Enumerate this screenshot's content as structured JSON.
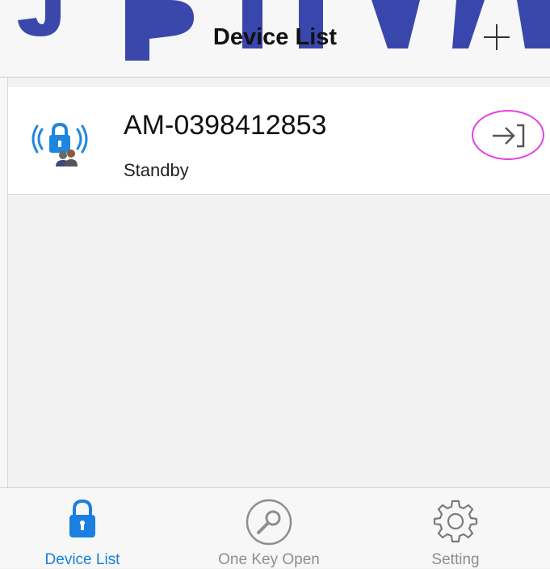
{
  "header": {
    "title": "Device List"
  },
  "devices": [
    {
      "name": "AM-0398412853",
      "status": "Standby"
    }
  ],
  "tabs": [
    {
      "label": "Device List",
      "icon": "lock-icon",
      "active": true
    },
    {
      "label": "One Key Open",
      "icon": "key-icon",
      "active": false
    },
    {
      "label": "Setting",
      "icon": "gear-icon",
      "active": false
    }
  ],
  "colors": {
    "accent": "#1a7fe0",
    "highlight": "#e23fe6",
    "watermark": "#2f3ea8"
  }
}
